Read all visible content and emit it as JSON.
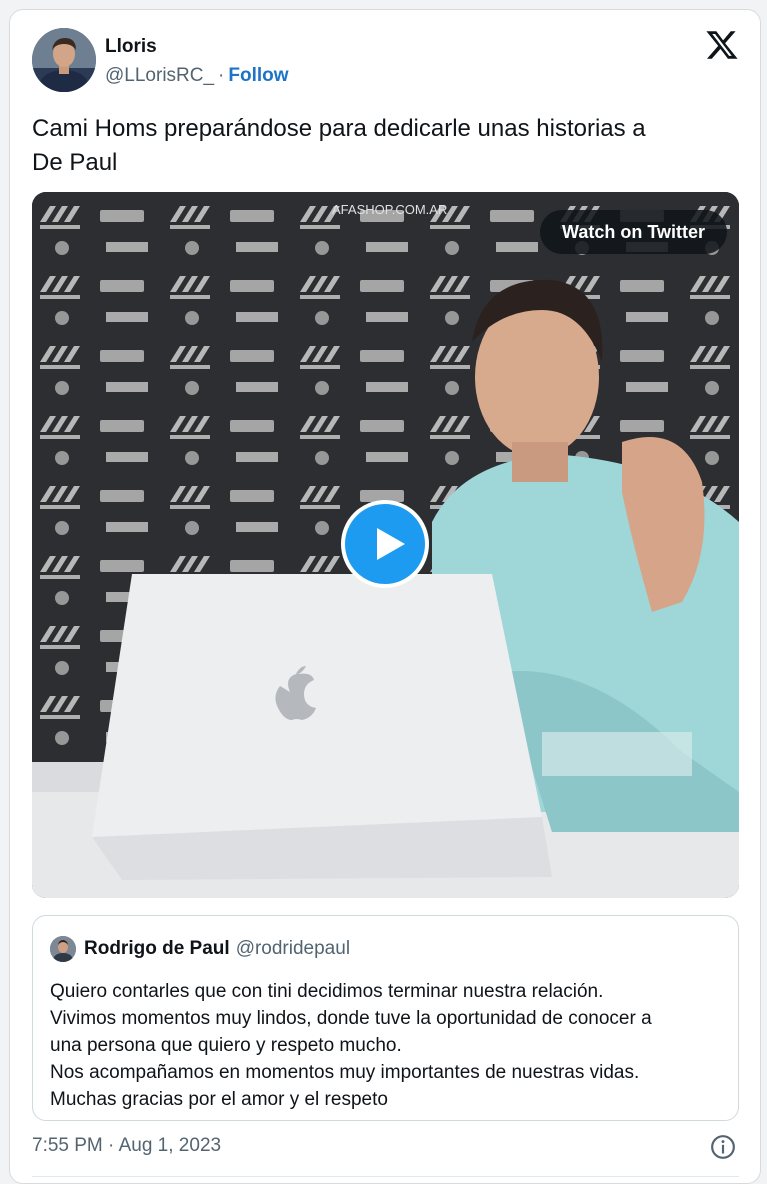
{
  "author": {
    "display_name": "Lloris",
    "handle": "@LLorisRC_",
    "separator": "·",
    "follow_label": "Follow"
  },
  "tweet": {
    "text_line1": "Cami Homs preparándose para dedicarle unas historias a",
    "text_line2": "De Paul"
  },
  "media": {
    "watch_label": "Watch on Twitter",
    "icons": [
      "play-icon",
      "apple-logo",
      "x-logo"
    ]
  },
  "quoted_tweet": {
    "name": "Rodrigo de Paul",
    "handle": "@rodridepaul",
    "lines": [
      "Quiero contarles que con tini decidimos terminar nuestra relación.",
      "Vivimos momentos muy lindos, donde tuve la oportunidad de conocer a",
      "una persona que quiero y respeto mucho.",
      "Nos acompañamos en momentos muy importantes de nuestras vidas.",
      "Muchas gracias por el amor y el respeto"
    ]
  },
  "footer": {
    "timestamp": "7:55 PM · Aug 1, 2023"
  },
  "colors": {
    "link": "#1d74c8",
    "play_button": "#1d9bf0",
    "jersey": "#9fd6d8"
  }
}
